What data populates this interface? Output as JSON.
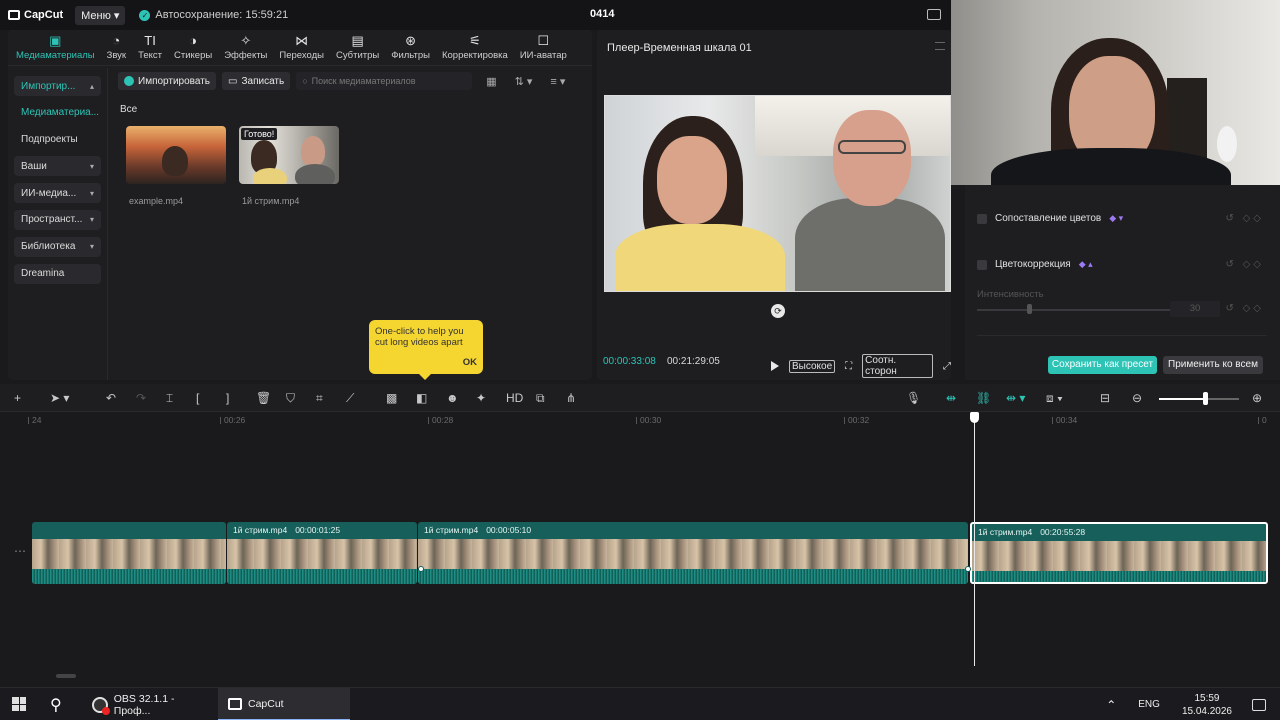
{
  "app": {
    "brand": "CapCut",
    "menu_label": "Меню",
    "autosave": "Автосохранение: 15:59:21",
    "project_name": "0414"
  },
  "toolbar": {
    "items": [
      {
        "icon": "media-icon",
        "label": "Медиаматериалы"
      },
      {
        "icon": "sound-icon",
        "label": "Звук"
      },
      {
        "icon": "text-icon",
        "label": "Текст"
      },
      {
        "icon": "stickers-icon",
        "label": "Стикеры"
      },
      {
        "icon": "effects-icon",
        "label": "Эффекты"
      },
      {
        "icon": "transitions-icon",
        "label": "Переходы"
      },
      {
        "icon": "subtitles-icon",
        "label": "Субтитры"
      },
      {
        "icon": "filters-icon",
        "label": "Фильтры"
      },
      {
        "icon": "adjust-icon",
        "label": "Корректировка"
      },
      {
        "icon": "ai-avatar-icon",
        "label": "ИИ-аватар"
      }
    ]
  },
  "sidebar": {
    "items": [
      {
        "label": "Импортир...",
        "chevron": "▴"
      },
      {
        "label": "Медиаматериа..."
      },
      {
        "label": "Подпроекты"
      },
      {
        "label": "Ваши",
        "chevron": "▾"
      },
      {
        "label": "ИИ-медиа...",
        "chevron": "▾"
      },
      {
        "label": "Пространст...",
        "chevron": "▾"
      },
      {
        "label": "Библиотека",
        "chevron": "▾"
      },
      {
        "label": "Dreamina"
      }
    ]
  },
  "media": {
    "import_label": "Импортировать",
    "record_label": "Записать",
    "search_placeholder": "Поиск медиаматериалов",
    "filter_all": "Все",
    "files": [
      {
        "name": "example.mp4"
      },
      {
        "name": "1й стрим.mp4",
        "badge": "Готово!"
      }
    ]
  },
  "tooltip": {
    "text": "One-click to help you cut long videos apart",
    "ok": "OK"
  },
  "player": {
    "title": "Плеер-Временная шкала 01",
    "current_time": "00:00:33:08",
    "total_time": "00:21:29:05",
    "quality": "Высокое",
    "aspect": "Соотн. сторон"
  },
  "properties": {
    "color_match": "Сопоставление цветов",
    "color_correction": "Цветокоррекция",
    "intensity_label": "Интенсивность",
    "intensity_value": "30",
    "save_preset": "Сохранить как пресет",
    "apply_all": "Применить ко всем"
  },
  "timeline": {
    "ruler": [
      "24",
      "00:26",
      "00:28",
      "00:30",
      "00:32",
      "00:34",
      "0"
    ],
    "clips": [
      {
        "name": "",
        "duration": ""
      },
      {
        "name": "1й стрим.mp4",
        "duration": "00:00:01:25"
      },
      {
        "name": "1й стрим.mp4",
        "duration": "00:00:05:10"
      },
      {
        "name": "1й стрим.mp4",
        "duration": "00:20:55:28"
      }
    ]
  },
  "taskbar": {
    "apps": [
      {
        "label": "OBS 32.1.1 - Проф..."
      },
      {
        "label": "CapCut"
      }
    ],
    "lang": "ENG",
    "time": "15:59",
    "date": "15.04.2026"
  },
  "colors": {
    "accent": "#2dc4b6",
    "tooltip": "#f5d530",
    "clip": "#175f5a"
  }
}
